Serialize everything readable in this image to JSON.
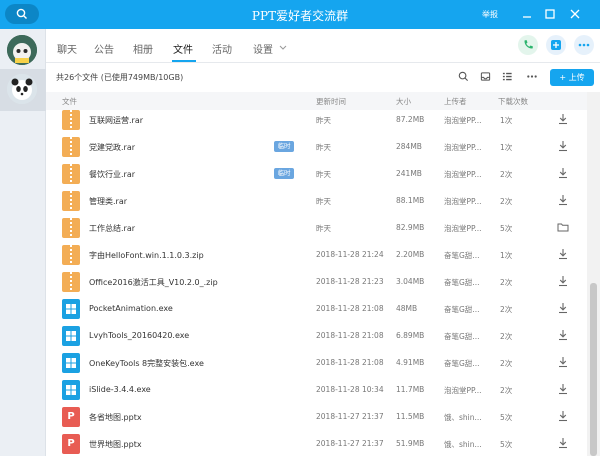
{
  "window": {
    "title": "PPT爱好者交流群",
    "report_label": "举报"
  },
  "tabs": [
    {
      "label": "聊天"
    },
    {
      "label": "公告"
    },
    {
      "label": "相册"
    },
    {
      "label": "文件"
    },
    {
      "label": "活动"
    },
    {
      "label": "设置"
    }
  ],
  "active_tab": "文件",
  "toolbar": {
    "file_count": "共26个文件 (已使用749MB/10GB)",
    "upload_label": "+ 上传"
  },
  "columns": {
    "name": "文件",
    "updated": "更新时间",
    "size": "大小",
    "uploader": "上传者",
    "downloads": "下载次数"
  },
  "files": [
    {
      "icon": "zip",
      "name": "互联网运营.rar",
      "tag": "",
      "time": "昨天",
      "size": "87.2MB",
      "uploader": "泡泡堂PP...",
      "downloads": "1次",
      "action": "download"
    },
    {
      "icon": "zip",
      "name": "党建党政.rar",
      "tag": "临时",
      "time": "昨天",
      "size": "284MB",
      "uploader": "泡泡堂PP...",
      "downloads": "1次",
      "action": "download"
    },
    {
      "icon": "zip",
      "name": "餐饮行业.rar",
      "tag": "临时",
      "time": "昨天",
      "size": "241MB",
      "uploader": "泡泡堂PP...",
      "downloads": "2次",
      "action": "download"
    },
    {
      "icon": "zip",
      "name": "管理类.rar",
      "tag": "",
      "time": "昨天",
      "size": "88.1MB",
      "uploader": "泡泡堂PP...",
      "downloads": "2次",
      "action": "download"
    },
    {
      "icon": "zip",
      "name": "工作总结.rar",
      "tag": "",
      "time": "昨天",
      "size": "82.9MB",
      "uploader": "泡泡堂PP...",
      "downloads": "5次",
      "action": "folder"
    },
    {
      "icon": "zip",
      "name": "字由HelloFont.win.1.1.0.3.zip",
      "tag": "",
      "time": "2018-11-28 21:24",
      "size": "2.20MB",
      "uploader": "奋笔G甜...",
      "downloads": "1次",
      "action": "download"
    },
    {
      "icon": "zip",
      "name": "Office2016激活工具_V10.2.0_.zip",
      "tag": "",
      "time": "2018-11-28 21:23",
      "size": "3.04MB",
      "uploader": "奋笔G甜...",
      "downloads": "2次",
      "action": "download"
    },
    {
      "icon": "exe",
      "name": "PocketAnimation.exe",
      "tag": "",
      "time": "2018-11-28 21:08",
      "size": "48MB",
      "uploader": "奋笔G甜...",
      "downloads": "2次",
      "action": "download"
    },
    {
      "icon": "exe",
      "name": "LvyhTools_20160420.exe",
      "tag": "",
      "time": "2018-11-28 21:08",
      "size": "6.89MB",
      "uploader": "奋笔G甜...",
      "downloads": "2次",
      "action": "download"
    },
    {
      "icon": "exe",
      "name": "OneKeyTools 8完整安装包.exe",
      "tag": "",
      "time": "2018-11-28 21:08",
      "size": "4.91MB",
      "uploader": "奋笔G甜...",
      "downloads": "2次",
      "action": "download"
    },
    {
      "icon": "exe",
      "name": "iSlide-3.4.4.exe",
      "tag": "",
      "time": "2018-11-28 10:34",
      "size": "11.7MB",
      "uploader": "泡泡堂PP...",
      "downloads": "2次",
      "action": "download"
    },
    {
      "icon": "ppt",
      "name": "各省地图.pptx",
      "tag": "",
      "time": "2018-11-27 21:37",
      "size": "11.5MB",
      "uploader": "饿、shin...",
      "downloads": "5次",
      "action": "download"
    },
    {
      "icon": "ppt",
      "name": "世界地图.pptx",
      "tag": "",
      "time": "2018-11-27 21:37",
      "size": "51.9MB",
      "uploader": "饿、shin...",
      "downloads": "5次",
      "action": "download"
    }
  ],
  "colors": {
    "accent": "#15a5ef",
    "archive": "#f3ad55",
    "exe": "#1ba1e2",
    "ppt": "#e85c53",
    "tag": "#6aa6e0"
  },
  "icons": {
    "search": "search-icon",
    "minimize": "minimize-icon",
    "maximize": "maximize-icon",
    "close": "close-icon",
    "phone": "phone-icon",
    "add": "add-icon",
    "more": "more-icon",
    "download": "download-icon",
    "folder": "folder-icon"
  }
}
